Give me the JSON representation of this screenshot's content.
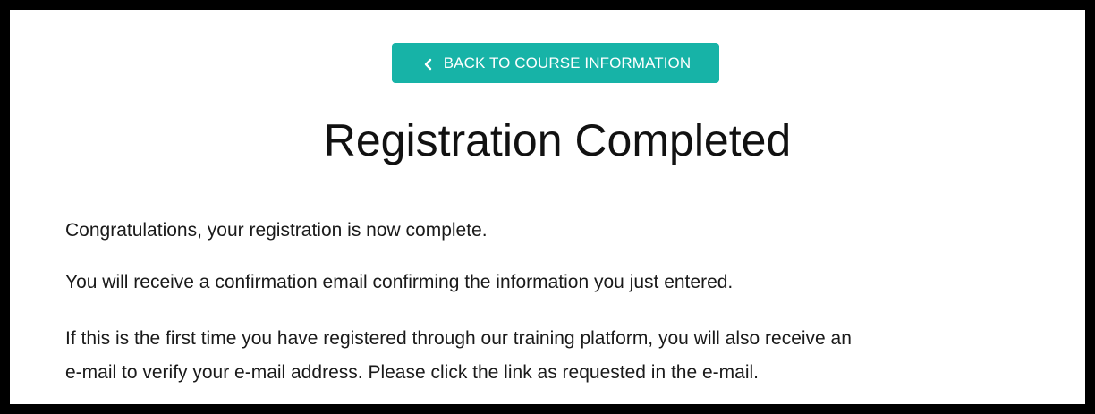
{
  "back_button": {
    "label": "BACK TO COURSE INFORMATION",
    "icon": "chevron-left-icon"
  },
  "page": {
    "title": "Registration Completed",
    "paragraphs": [
      "Congratulations, your registration is now complete.",
      "You will receive a confirmation email confirming the information you just entered.",
      "If this is the first time you have registered through our training platform, you will also receive an",
      "e-mail to verify your e-mail address. Please click the link as requested in the e-mail."
    ]
  },
  "colors": {
    "accent": "#17b3a7",
    "border": "#000000",
    "text": "#1a1a1a"
  }
}
